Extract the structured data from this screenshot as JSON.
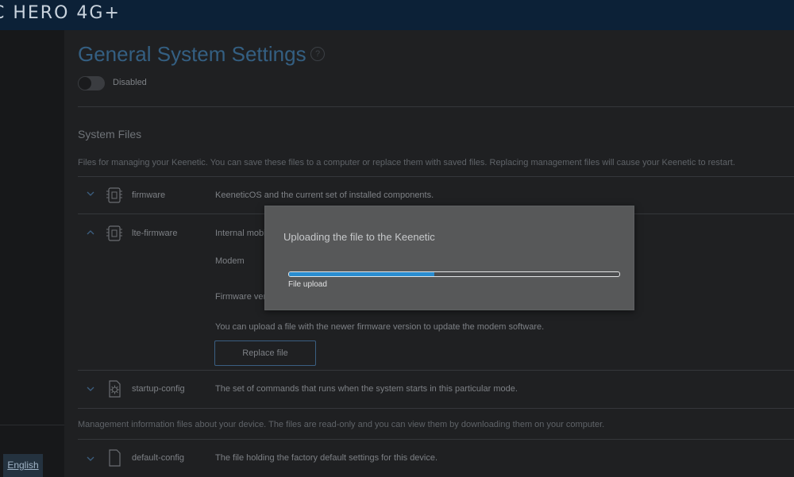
{
  "header": {
    "brand": "C HERO 4G+"
  },
  "sidebar": {
    "language_label": "English"
  },
  "page": {
    "title": "General System Settings",
    "help_glyph": "?",
    "toggle_state_label": "Disabled",
    "toggle_on": false
  },
  "system_files": {
    "title": "System Files",
    "description": "Files for managing your Keenetic. You can save these files to a computer or replace them with saved files. Replacing management files will cause your Keenetic to restart.",
    "items": [
      {
        "name": "firmware",
        "description": "KeeneticOS and the current set of installed components.",
        "icon": "chip-icon",
        "expanded": false
      },
      {
        "name": "lte-firmware",
        "description": "Internal mobil",
        "icon": "chip-icon",
        "expanded": true,
        "details": {
          "modem_label": "Modem",
          "firmware_version_label": "Firmware vers",
          "upload_hint": "You can upload a file with the newer firmware version to update the modem software.",
          "replace_button": "Replace file"
        }
      },
      {
        "name": "startup-config",
        "description": "The set of commands that runs when the system starts in this particular mode.",
        "icon": "gear-icon",
        "expanded": false
      }
    ]
  },
  "management_files": {
    "description": "Management information files about your device. The files are read-only and you can view them by downloading them on your computer.",
    "items": [
      {
        "name": "default-config",
        "description": "The file holding the factory default settings for this device.",
        "icon": "document-icon",
        "expanded": false
      }
    ]
  },
  "modal": {
    "title": "Uploading the file to the Keenetic",
    "progress_label": "File upload",
    "progress_fraction": 0.44
  },
  "colors": {
    "accent": "#2a8dd0",
    "title": "#345f82",
    "topbar": "#0c2137"
  }
}
